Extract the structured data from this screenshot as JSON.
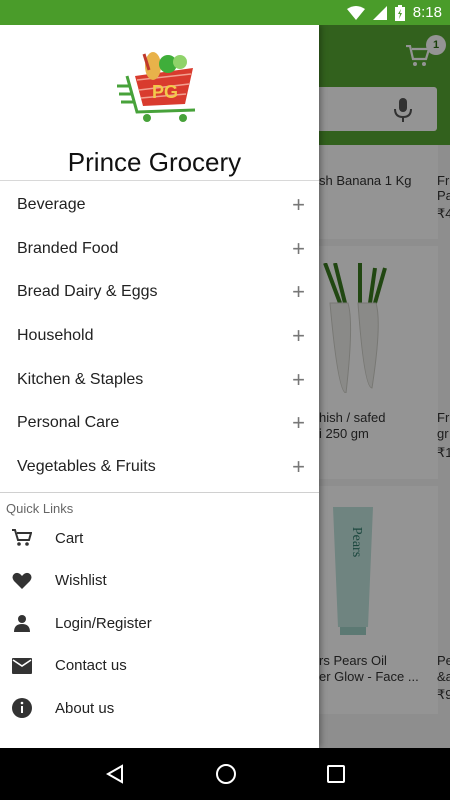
{
  "status_bar": {
    "time": "8:18"
  },
  "app": {
    "cart_count": "1",
    "products": [
      {
        "name": "sh Banana 1 Kg",
        "price": ""
      },
      {
        "name": "Fr",
        "name2": "Pa",
        "price": "₹4"
      },
      {
        "name": "hish / safed",
        "name2": "i 250 gm",
        "price": ""
      },
      {
        "name": "Fr",
        "name2": "gr",
        "price": "₹1"
      },
      {
        "name": "rs Pears Oil",
        "name2": "er Glow - Face ...",
        "price": ""
      },
      {
        "name": "Pe",
        "name2": "&a",
        "price": "₹9"
      }
    ]
  },
  "drawer": {
    "brand": "Prince Grocery",
    "logo_text": "PG",
    "categories": [
      {
        "label": "Beverage"
      },
      {
        "label": "Branded Food"
      },
      {
        "label": "Bread Dairy & Eggs"
      },
      {
        "label": "Household"
      },
      {
        "label": "Kitchen & Staples"
      },
      {
        "label": "Personal Care"
      },
      {
        "label": "Vegetables & Fruits"
      }
    ],
    "quick_links_title": "Quick Links",
    "quick_links": [
      {
        "label": "Cart",
        "icon": "cart-icon"
      },
      {
        "label": "Wishlist",
        "icon": "heart-icon"
      },
      {
        "label": "Login/Register",
        "icon": "person-icon"
      },
      {
        "label": "Contact us",
        "icon": "mail-icon"
      },
      {
        "label": "About us",
        "icon": "info-icon"
      }
    ]
  },
  "colors": {
    "primary": "#57a832",
    "status": "#4a9c2a"
  }
}
